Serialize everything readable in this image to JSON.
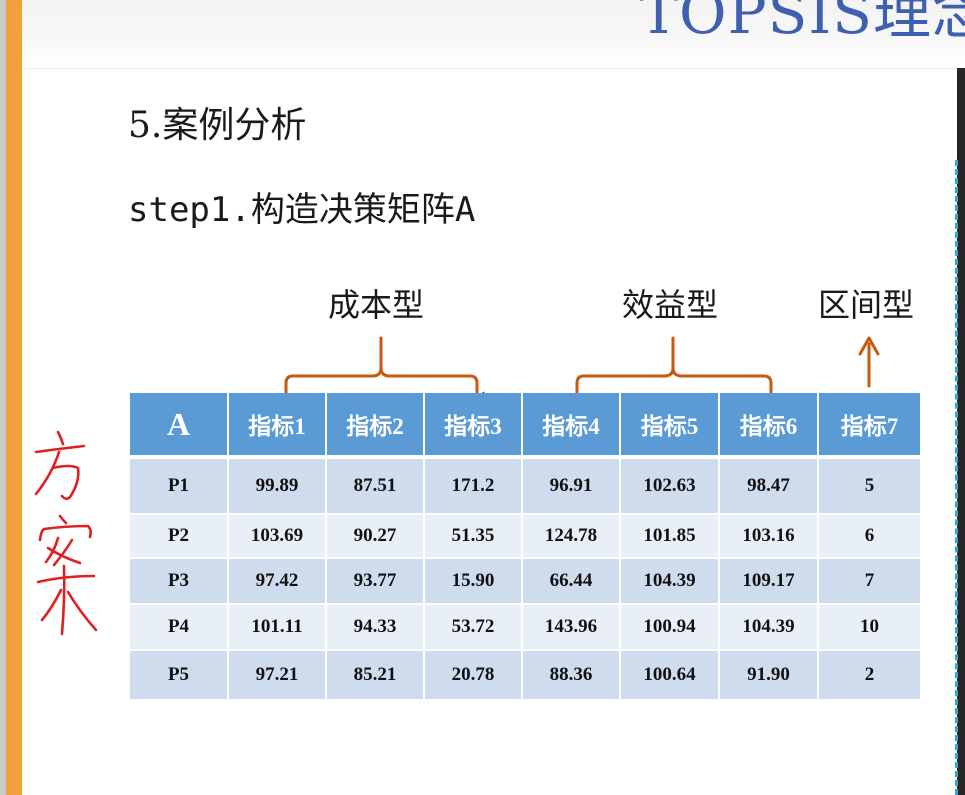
{
  "header": {
    "title": "TOPSIS理念"
  },
  "section_title": "5.案例分析",
  "step_title": "step1.构造决策矩阵A",
  "groups": {
    "cost": "成本型",
    "benefit": "效益型",
    "interval": "区间型"
  },
  "handwriting": "方案",
  "colors": {
    "header_fill": "#5b9bd5",
    "row_dark": "#cfdcee",
    "row_light": "#e9eff7",
    "bracket": "#c55a11",
    "handwriting": "#e02020",
    "accent_bar": "#f1a13a"
  },
  "table": {
    "columns": [
      "A",
      "指标1",
      "指标2",
      "指标3",
      "指标4",
      "指标5",
      "指标6",
      "指标7"
    ],
    "rows": [
      [
        "P1",
        "99.89",
        "87.51",
        "171.2",
        "96.91",
        "102.63",
        "98.47",
        "5"
      ],
      [
        "P2",
        "103.69",
        "90.27",
        "51.35",
        "124.78",
        "101.85",
        "103.16",
        "6"
      ],
      [
        "P3",
        "97.42",
        "93.77",
        "15.90",
        "66.44",
        "104.39",
        "109.17",
        "7"
      ],
      [
        "P4",
        "101.11",
        "94.33",
        "53.72",
        "143.96",
        "100.94",
        "104.39",
        "10"
      ],
      [
        "P5",
        "97.21",
        "85.21",
        "20.78",
        "88.36",
        "100.64",
        "91.90",
        "2"
      ]
    ]
  }
}
